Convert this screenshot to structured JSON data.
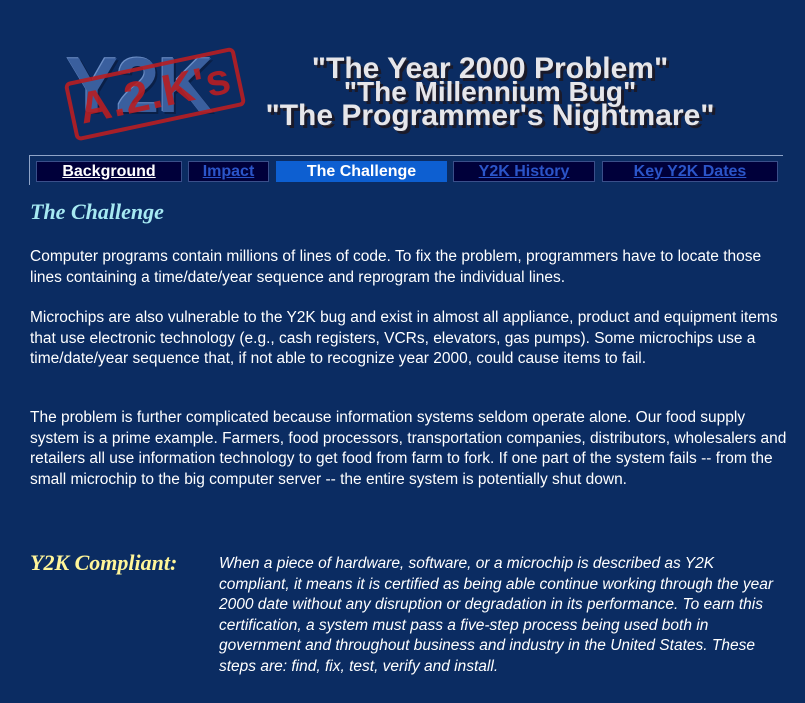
{
  "banner": {
    "logo_text": "Y2K",
    "stamp_text": "A.2.K's",
    "line1": "\"The Year 2000 Problem\"",
    "line2": "\"The Millennium Bug\"",
    "line3": "\"The Programmer's Nightmare\""
  },
  "nav": {
    "tabs": [
      {
        "label": "Background",
        "state": "visited"
      },
      {
        "label": "Impact",
        "state": "link"
      },
      {
        "label": "The Challenge",
        "state": "active"
      },
      {
        "label": "Y2K History",
        "state": "link"
      },
      {
        "label": "Key Y2K Dates",
        "state": "link"
      }
    ]
  },
  "content": {
    "title": "The Challenge",
    "paragraphs": [
      "Computer programs contain millions of lines of code. To fix the problem, programmers have to locate those lines containing a time/date/year sequence and reprogram the individual lines.",
      "Microchips are also vulnerable to the Y2K bug and exist in almost all appliance, product and equipment items that use electronic technology (e.g., cash registers, VCRs, elevators, gas pumps). Some microchips use a time/date/year sequence that, if not able to recognize year 2000, could cause items to fail.",
      "The problem is further complicated because information systems seldom operate alone. Our food supply system is a prime example. Farmers, food processors, transportation companies, distributors, wholesalers and retailers all use information technology to get food from farm to fork. If one part of the system fails -- from the small microchip to the big computer server -- the entire system is potentially shut down."
    ]
  },
  "glossary": {
    "term": "Y2K Compliant:",
    "definition": "When a piece of hardware, software, or a microchip is described as Y2K compliant, it means it is certified as being able continue working through the year 2000 date without any disruption or degradation in its performance. To earn this certification, a system must pass a five-step process being used both in government and throughout business and industry in the United States. These steps are: find, fix, test, verify and install."
  },
  "colors": {
    "background": "#0b2c62",
    "active_tab": "#0d5fd1",
    "link": "#2b55c9",
    "title": "#a6e9f2",
    "term": "#fff599"
  }
}
